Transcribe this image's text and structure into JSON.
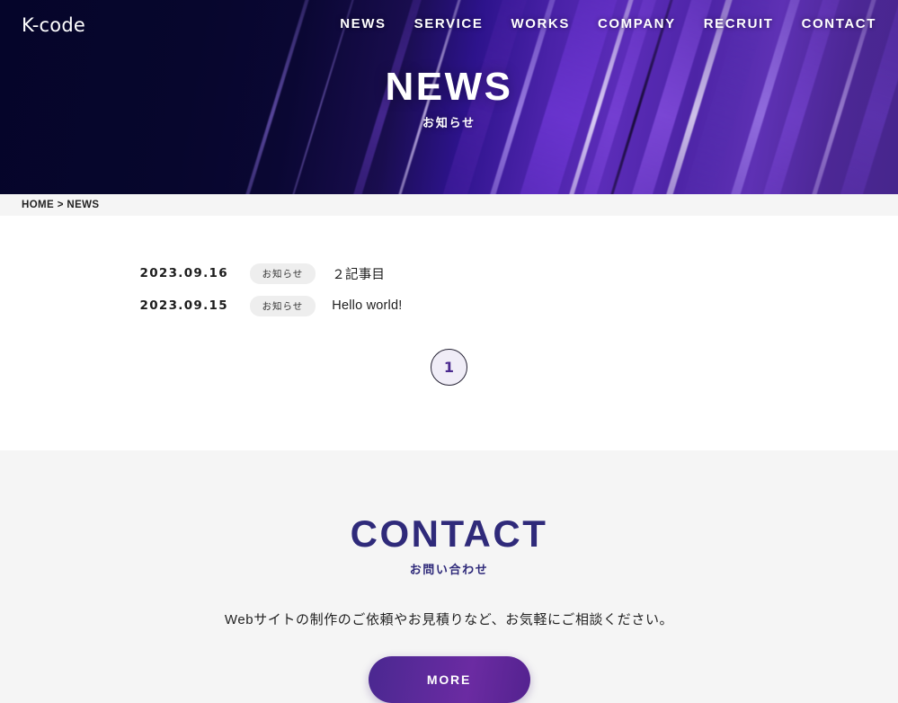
{
  "header": {
    "logo": "K-code",
    "nav": [
      {
        "label": "NEWS"
      },
      {
        "label": "SERVICE"
      },
      {
        "label": "WORKS"
      },
      {
        "label": "COMPANY"
      },
      {
        "label": "RECRUIT"
      },
      {
        "label": "CONTACT"
      }
    ]
  },
  "hero": {
    "title": "NEWS",
    "subtitle": "お知らせ"
  },
  "breadcrumb": {
    "text": "HOME > NEWS"
  },
  "news": {
    "items": [
      {
        "date": "2023.09.16",
        "category": "お知らせ",
        "title": "２記事目"
      },
      {
        "date": "2023.09.15",
        "category": "お知らせ",
        "title": "Hello world!"
      }
    ],
    "pagination": {
      "current": "1"
    }
  },
  "contact": {
    "title": "CONTACT",
    "subtitle": "お問い合わせ",
    "description": "Webサイトの制作のご依頼やお見積りなど、お気軽にご相談ください。",
    "button_label": "MORE"
  },
  "colors": {
    "hero_dark": "#05052a",
    "hero_purple": "#5b2cb8",
    "accent_indigo": "#2f2a7a",
    "pagination_text": "#4b2a8f",
    "section_bg": "#f5f5f5"
  }
}
